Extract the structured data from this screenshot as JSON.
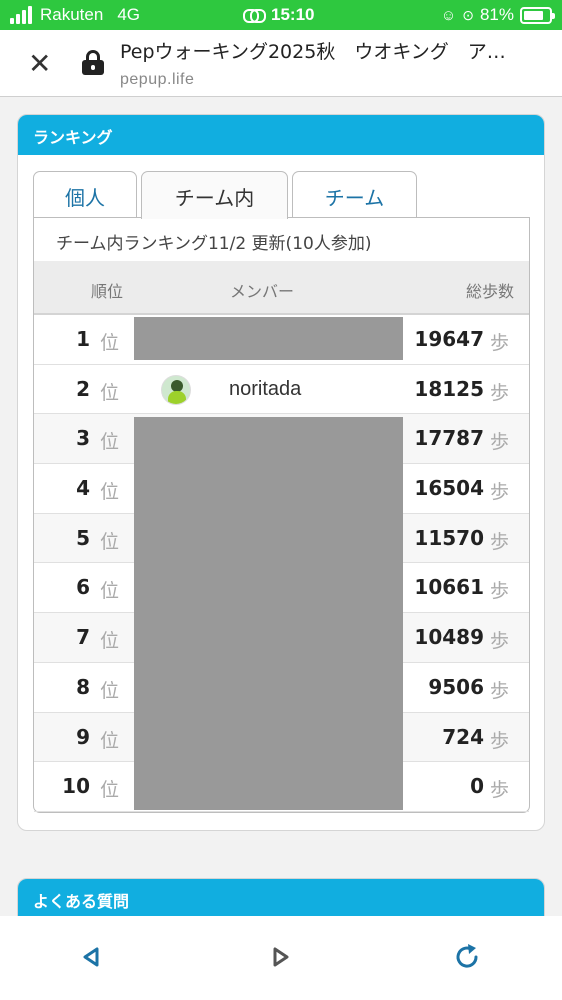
{
  "status": {
    "carrier": "Rakuten",
    "network": "4G",
    "time": "15:10",
    "battery": "81%",
    "battery_level": 0.81,
    "color": "#2ec83f"
  },
  "urlbar": {
    "title": "Pepウォーキング2025秋　ウオキング　ア…",
    "domain": "pepup.life",
    "close_icon": "close-icon",
    "lock_icon": "lock-icon"
  },
  "ranking": {
    "header": "ランキング",
    "tabs": [
      {
        "label": "個人",
        "active": false
      },
      {
        "label": "チーム内",
        "active": true
      },
      {
        "label": "チーム",
        "active": false
      }
    ],
    "subtitle": "チーム内ランキング11/2 更新(10人参加)",
    "columns": {
      "rank": "順位",
      "member": "メンバー",
      "steps": "総歩数"
    },
    "rank_unit": "位",
    "steps_unit": "歩",
    "rows": [
      {
        "rank": "1",
        "name": "",
        "steps": "19647"
      },
      {
        "rank": "2",
        "name": "noritada",
        "steps": "18125"
      },
      {
        "rank": "3",
        "name": "",
        "steps": "17787"
      },
      {
        "rank": "4",
        "name": "",
        "steps": "16504"
      },
      {
        "rank": "5",
        "name": "",
        "steps": "11570"
      },
      {
        "rank": "6",
        "name": "",
        "steps": "10661"
      },
      {
        "rank": "7",
        "name": "",
        "steps": "10489"
      },
      {
        "rank": "8",
        "name": "",
        "steps": "9506"
      },
      {
        "rank": "9",
        "name": "",
        "steps": "724"
      },
      {
        "rank": "10",
        "name": "",
        "steps": "0"
      }
    ],
    "accent": "#11aee0"
  },
  "faq": {
    "header": "よくある質問"
  },
  "navbar": {
    "back_icon": "back-triangle-icon",
    "forward_icon": "forward-triangle-icon",
    "reload_icon": "reload-icon"
  }
}
